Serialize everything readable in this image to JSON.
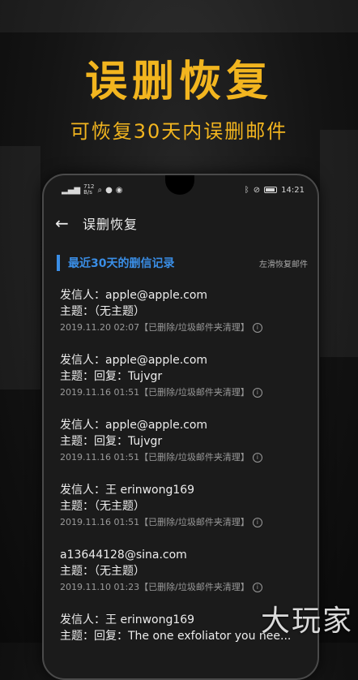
{
  "promo": {
    "headline": "误删恢复",
    "subheadline": "可恢复30天内误删邮件"
  },
  "status_bar": {
    "net_speed_value": "712",
    "net_speed_unit": "B/s",
    "time": "14:21"
  },
  "app_bar": {
    "back_icon": "arrow-left-icon",
    "title": "误删恢复"
  },
  "section": {
    "title": "最近30天的删信记录",
    "hint": "左滑恢复邮件"
  },
  "mails": [
    {
      "from": "发信人：apple@apple.com",
      "subject": "主题：（无主题）",
      "meta": "2019.11.20 02:07【已删除/垃圾邮件夹清理】"
    },
    {
      "from": "发信人：apple@apple.com",
      "subject": "主题：回复：Tujvgr",
      "meta": "2019.11.16 01:51【已删除/垃圾邮件夹清理】"
    },
    {
      "from": "发信人：apple@apple.com",
      "subject": "主题：回复：Tujvgr",
      "meta": "2019.11.16 01:51【已删除/垃圾邮件夹清理】"
    },
    {
      "from": "发信人：王 erinwong169",
      "subject": "主题：（无主题）",
      "meta": "2019.11.16 01:51【已删除/垃圾邮件夹清理】"
    },
    {
      "from": "a13644128@sina.com",
      "subject": "主题：（无主题）",
      "meta": "2019.11.10 01:23【已删除/垃圾邮件夹清理】"
    },
    {
      "from": "发信人：王 erinwong169",
      "subject": "主题：回复：The one exfoliator you nee...",
      "meta": ""
    }
  ],
  "watermark": "大玩家",
  "colors": {
    "accent": "#f2b51f",
    "section_blue": "#3a8ee6"
  }
}
